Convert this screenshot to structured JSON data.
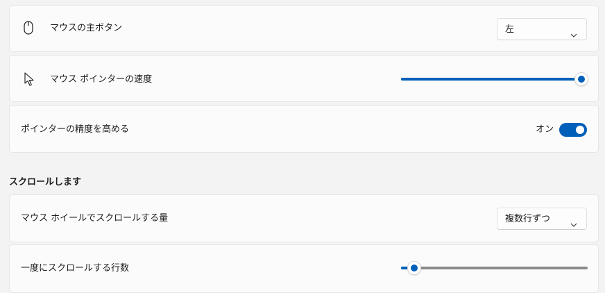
{
  "primary_button": {
    "label": "マウスの主ボタン",
    "icon": "mouse-icon",
    "selected": "左"
  },
  "pointer_speed": {
    "label": "マウス ポインターの速度",
    "icon": "pointer-icon",
    "value_fraction": 1.0
  },
  "pointer_precision": {
    "label": "ポインターの精度を高める",
    "state_label": "オン",
    "on": true
  },
  "scroll_section": {
    "title": "スクロールします"
  },
  "wheel_scroll": {
    "label": "マウス ホイールでスクロールする量",
    "selected": "複数行ずつ"
  },
  "lines_to_scroll": {
    "label": "一度にスクロールする行数",
    "value_fraction": 0.07
  },
  "colors": {
    "accent": "#005fb8",
    "card": "#fbfbfb",
    "background": "#f3f3f3"
  }
}
